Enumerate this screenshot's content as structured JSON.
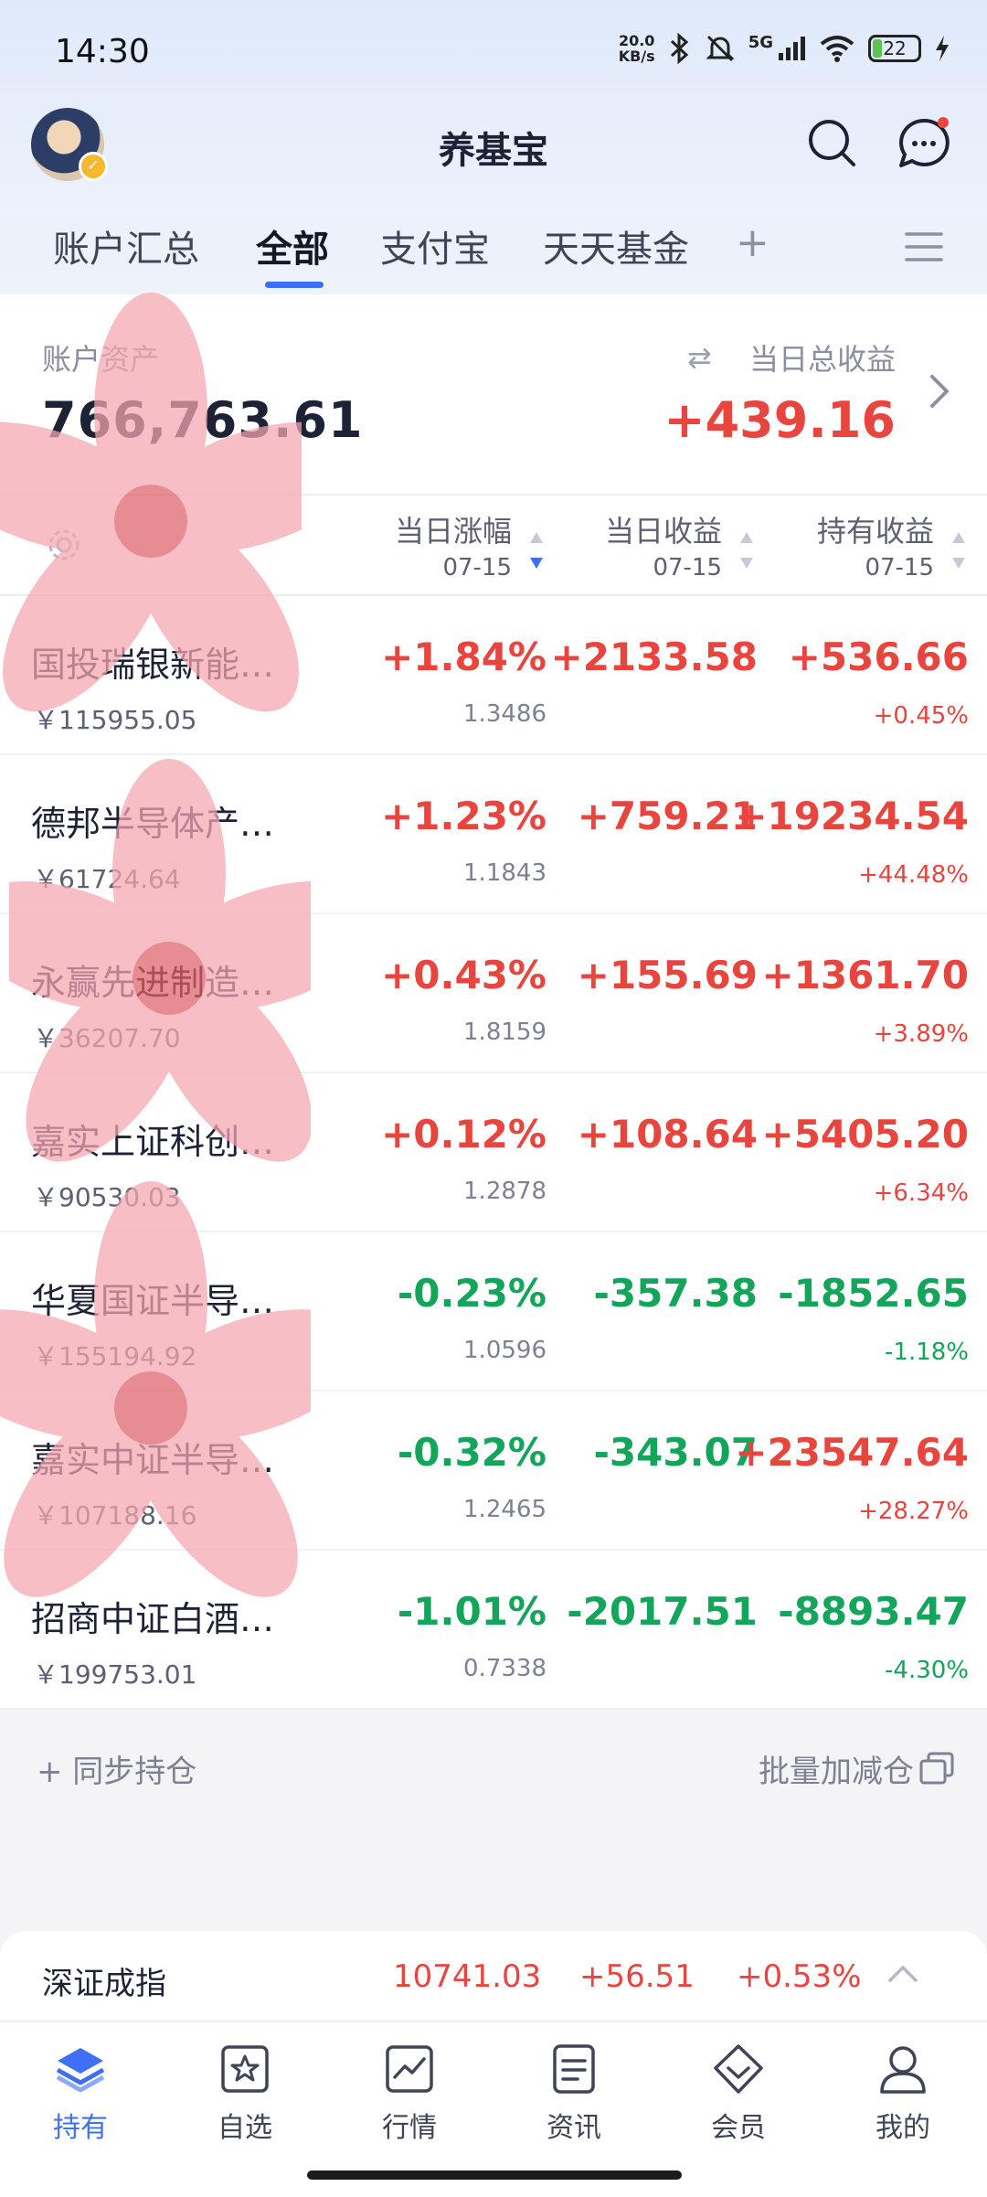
{
  "status_bar": {
    "time": "14:30",
    "net_speed_value": "20.0",
    "net_speed_unit": "KB/s",
    "signal_label": "5G",
    "battery": "22",
    "battery_level": 0.22
  },
  "header": {
    "title": "养基宝",
    "tabs": [
      "账户汇总",
      "全部",
      "支付宝",
      "天天基金"
    ],
    "active_tab_index": 1,
    "add_tab": "+"
  },
  "summary": {
    "assets_label": "账户资产",
    "assets_value": "766,763.61",
    "profit_label": "当日总收益",
    "profit_value": "+439.16"
  },
  "columns": [
    {
      "title": "当日涨幅",
      "date": "07-15"
    },
    {
      "title": "当日收益",
      "date": "07-15"
    },
    {
      "title": "持有收益",
      "date": "07-15"
    }
  ],
  "funds": [
    {
      "name": "国投瑞银新能…",
      "amount": "￥115955.05",
      "change": "+1.84%",
      "nav": "1.3486",
      "day_profit": "+2133.58",
      "hold_profit": "+536.66",
      "hold_pct": "+0.45%",
      "dir": "up",
      "hold_dir": "up"
    },
    {
      "name": "德邦半导体产…",
      "amount": "￥61724.64",
      "change": "+1.23%",
      "nav": "1.1843",
      "day_profit": "+759.21",
      "hold_profit": "+19234.54",
      "hold_pct": "+44.48%",
      "dir": "up",
      "hold_dir": "up"
    },
    {
      "name": "永赢先进制造…",
      "amount": "￥36207.70",
      "change": "+0.43%",
      "nav": "1.8159",
      "day_profit": "+155.69",
      "hold_profit": "+1361.70",
      "hold_pct": "+3.89%",
      "dir": "up",
      "hold_dir": "up"
    },
    {
      "name": "嘉实上证科创…",
      "amount": "￥90530.03",
      "change": "+0.12%",
      "nav": "1.2878",
      "day_profit": "+108.64",
      "hold_profit": "+5405.20",
      "hold_pct": "+6.34%",
      "dir": "up",
      "hold_dir": "up"
    },
    {
      "name": "华夏国证半导…",
      "amount": "￥155194.92",
      "change": "-0.23%",
      "nav": "1.0596",
      "day_profit": "-357.38",
      "hold_profit": "-1852.65",
      "hold_pct": "-1.18%",
      "dir": "down",
      "hold_dir": "down"
    },
    {
      "name": "嘉实中证半导…",
      "amount": "￥107188.16",
      "change": "-0.32%",
      "nav": "1.2465",
      "day_profit": "-343.07",
      "hold_profit": "+23547.64",
      "hold_pct": "+28.27%",
      "dir": "down",
      "hold_dir": "up"
    },
    {
      "name": "招商中证白酒…",
      "amount": "￥199753.01",
      "change": "-1.01%",
      "nav": "0.7338",
      "day_profit": "-2017.51",
      "hold_profit": "-8893.47",
      "hold_pct": "-4.30%",
      "dir": "down",
      "hold_dir": "down"
    }
  ],
  "actions": {
    "sync": "+ 同步持仓",
    "batch": "批量加减仓"
  },
  "ticker": {
    "name": "深证成指",
    "value": "10741.03",
    "change": "+56.51",
    "pct": "+0.53%"
  },
  "bottom_nav": {
    "items": [
      "持有",
      "自选",
      "行情",
      "资讯",
      "会员",
      "我的"
    ],
    "active_index": 0
  },
  "colors": {
    "accent": "#3f6ff5",
    "rise": "#e8453e",
    "fall": "#13a55a"
  }
}
